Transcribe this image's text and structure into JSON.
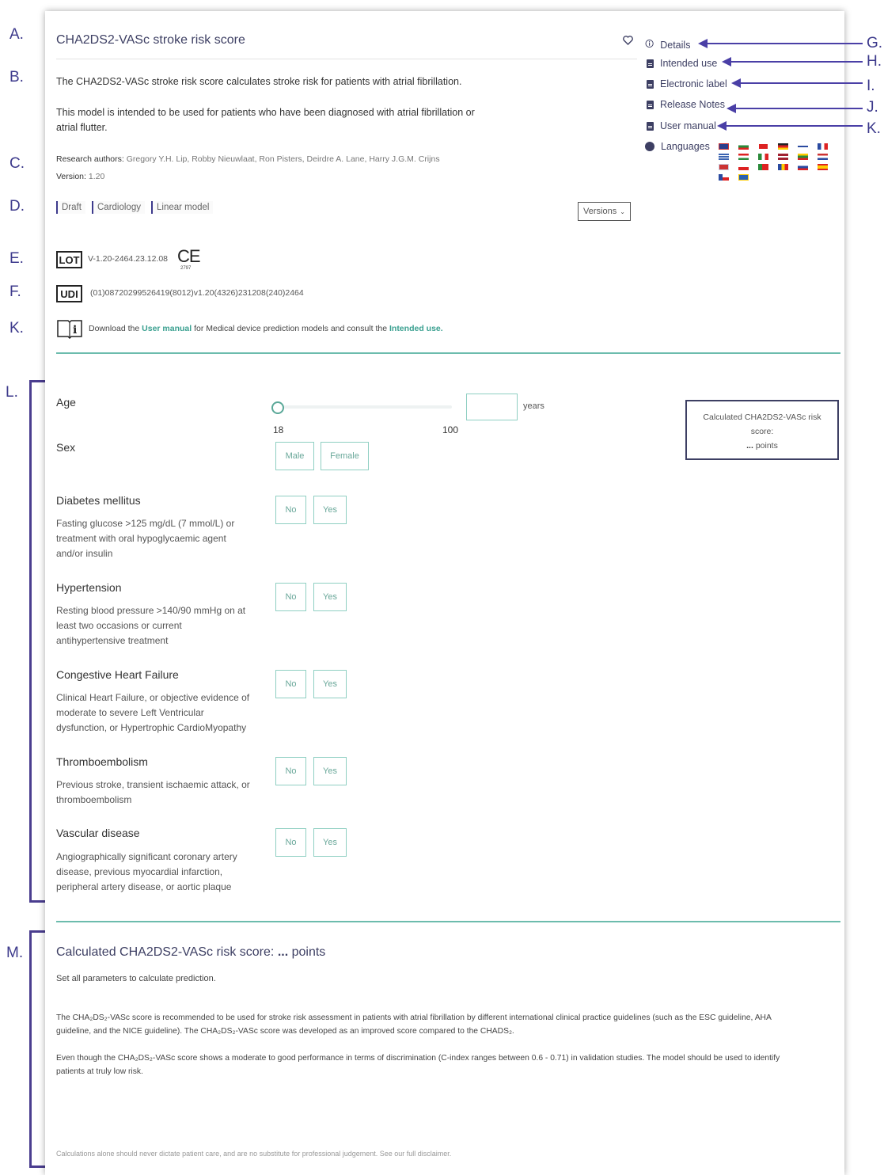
{
  "annotations": [
    "A.",
    "B.",
    "C.",
    "D.",
    "E.",
    "F.",
    "K.",
    "L.",
    "M.",
    "G.",
    "H.",
    "I.",
    "J.",
    "K."
  ],
  "header": {
    "title": "CHA2DS2-VASc stroke risk score",
    "favorite_icon": "heart-icon"
  },
  "description": {
    "line1": "The CHA2DS2-VASc stroke risk score calculates stroke risk for patients with atrial fibrillation.",
    "line2a": "This model is intended to be used for patients who have been diagnosed with atrial fibrillation or",
    "line2b": "atrial flutter."
  },
  "authors": {
    "label": "Research authors:",
    "names": "Gregory Y.H. Lip, Robby Nieuwlaat, Ron Pisters, Deirdre A. Lane, Harry J.G.M. Crijns",
    "version_label": "Version:",
    "version": "1.20"
  },
  "tags": [
    "Draft",
    "Cardiology",
    "Linear model"
  ],
  "versions_button": "Versions",
  "lot": {
    "label": "LOT",
    "value": "V-1.20-2464.23.12.08",
    "ce": "CE",
    "ce_number": "2797"
  },
  "udi": {
    "label": "UDI",
    "value": "(01)08720299526419(8012)v1.20(4326)231208(240)2464"
  },
  "manual_note": {
    "prefix": "Download the ",
    "link1": "User manual",
    "middle": " for Medical device prediction models and consult the ",
    "link2": "Intended use."
  },
  "sidebar": {
    "items": [
      {
        "label": "Details",
        "icon": "details-icon"
      },
      {
        "label": "Intended use",
        "icon": "document-icon"
      },
      {
        "label": "Electronic label",
        "icon": "document-icon"
      },
      {
        "label": "Release Notes",
        "icon": "document-icon"
      },
      {
        "label": "User manual",
        "icon": "document-icon"
      },
      {
        "label": "Languages",
        "icon": "globe-icon"
      }
    ]
  },
  "form": {
    "age": {
      "label": "Age",
      "min": "18",
      "max": "100",
      "unit": "years",
      "value": ""
    },
    "sex": {
      "label": "Sex",
      "options": [
        "Male",
        "Female"
      ]
    },
    "fields": [
      {
        "label": "Diabetes mellitus",
        "desc": "Fasting glucose >125 mg/dL (7 mmol/L) or treatment with oral hypoglycaemic agent and/or insulin"
      },
      {
        "label": "Hypertension",
        "desc": "Resting blood pressure >140/90 mmHg on at least two occasions or current antihypertensive treatment"
      },
      {
        "label": "Congestive Heart Failure",
        "desc": "Clinical Heart Failure, or objective evidence of moderate to severe Left Ventricular dysfunction, or Hypertrophic CardioMyopathy"
      },
      {
        "label": "Thromboembolism",
        "desc": "Previous stroke, transient ischaemic attack, or thromboembolism"
      },
      {
        "label": "Vascular disease",
        "desc": "Angiographically significant coronary artery disease, previous myocardial infarction, peripheral artery disease, or aortic plaque"
      }
    ],
    "no": "No",
    "yes": "Yes"
  },
  "score_box": {
    "line1": "Calculated CHA2DS2-VASc risk",
    "line2": "score:",
    "value": "...",
    "unit": "points"
  },
  "result": {
    "title": "Calculated CHA2DS2-VASc risk score:",
    "value": "...",
    "unit": "points",
    "hint": "Set all parameters to calculate prediction.",
    "para1a": "The CHA₂DS₂-VASc score is recommended to be used for stroke risk assessment in patients with atrial fibrillation by different international clinical practice guidelines (such as the ESC guideline, AHA",
    "para1b": "guideline, and the NICE guideline). The CHA₂DS₂-VASc score was developed as an improved score compared to the CHADS₂.",
    "para2a": "Even though the CHA₂DS₂-VASc score shows a moderate to good performance in terms of discrimination (C-index ranges between 0.6 - 0.71) in validation studies. The model should be used to identify",
    "para2b": "patients at truly low risk.",
    "disclaimer": "Calculations alone should never dictate patient care, and are no substitute for professional judgement. See our full disclaimer."
  }
}
